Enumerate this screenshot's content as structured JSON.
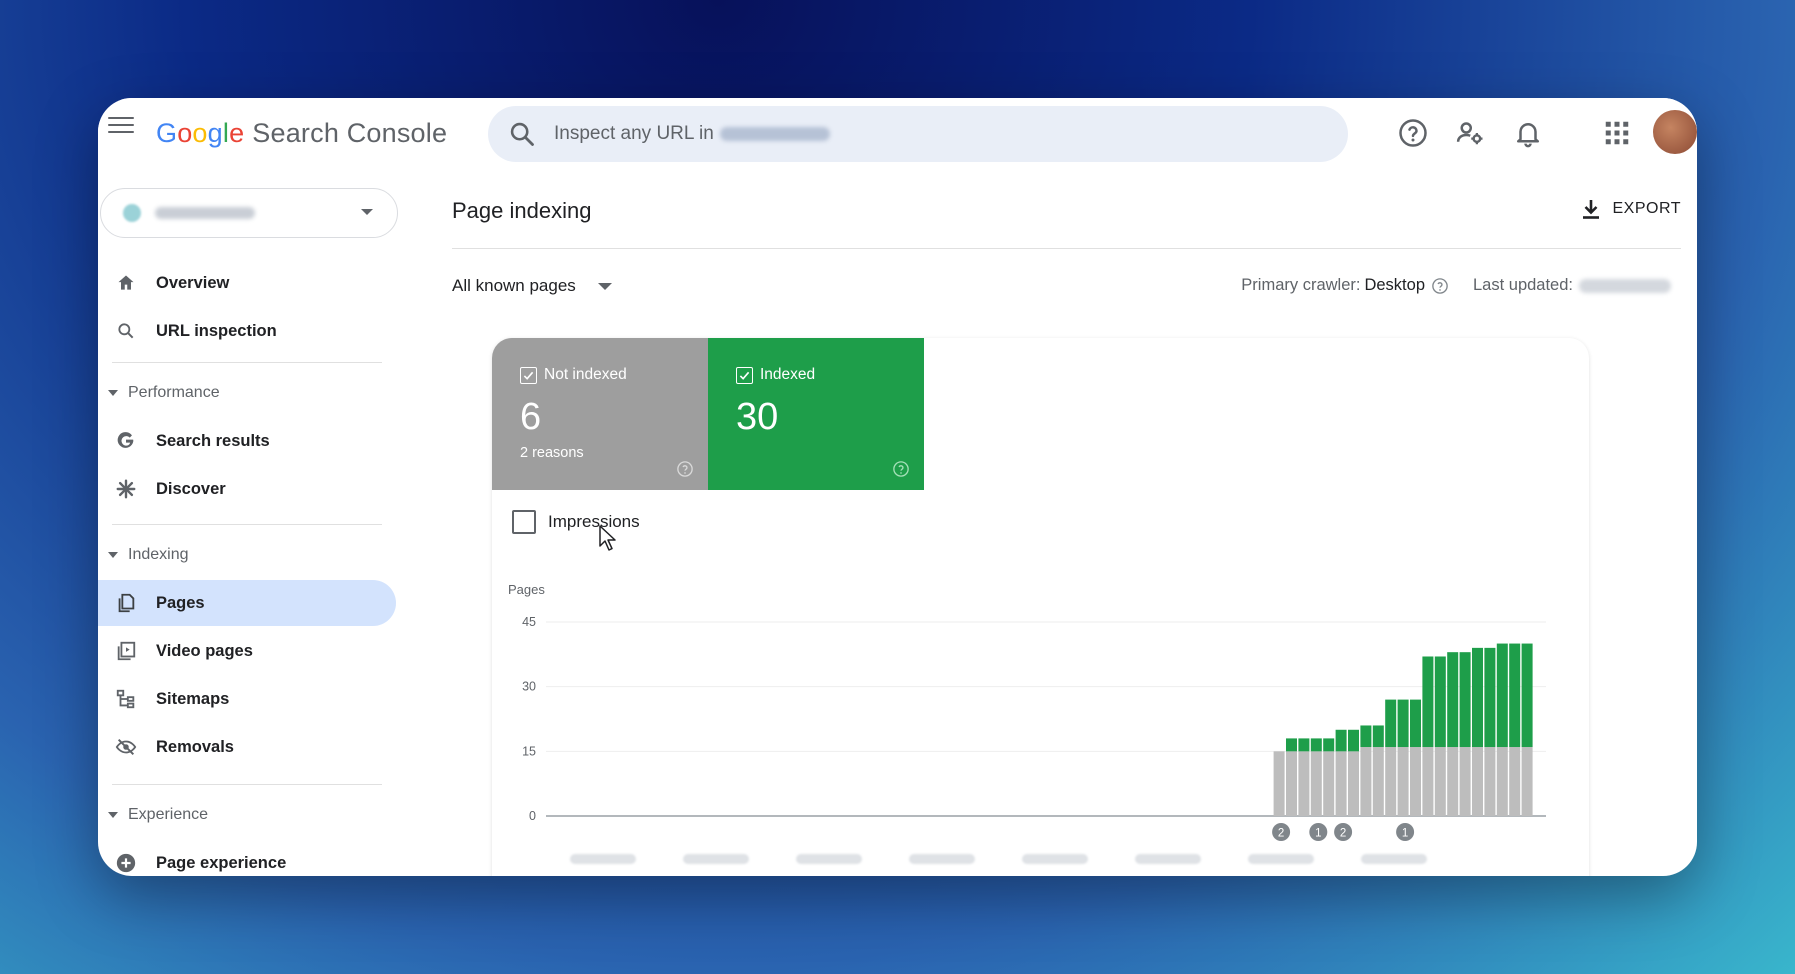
{
  "app": {
    "logo_letters": [
      "G",
      "o",
      "o",
      "g",
      "l",
      "e"
    ],
    "product": "Search Console",
    "search_placeholder": "Inspect any URL in"
  },
  "sidebar": {
    "items": {
      "overview": "Overview",
      "url_inspection": "URL inspection",
      "search_results": "Search results",
      "discover": "Discover",
      "pages": "Pages",
      "video_pages": "Video pages",
      "sitemaps": "Sitemaps",
      "removals": "Removals",
      "page_experience": "Page experience"
    },
    "sections": {
      "performance": "Performance",
      "indexing": "Indexing",
      "experience": "Experience"
    }
  },
  "main": {
    "title": "Page indexing",
    "export_label": "EXPORT",
    "filter_label": "All known pages",
    "crawler_label": "Primary crawler:",
    "crawler_value": "Desktop",
    "last_updated_label": "Last updated:",
    "tiles": {
      "not_indexed": {
        "label": "Not indexed",
        "value": "6",
        "sub": "2 reasons"
      },
      "indexed": {
        "label": "Indexed",
        "value": "30"
      }
    },
    "impressions_label": "Impressions"
  },
  "chart_data": {
    "type": "bar",
    "ylabel": "Pages",
    "yticks": [
      "45",
      "30",
      "15",
      "0"
    ],
    "ylim": [
      0,
      45
    ],
    "stacked": true,
    "colors": {
      "not_indexed": "#bdbdbd",
      "indexed": "#1e9e4a"
    },
    "series": [
      {
        "values": [
          15,
          15,
          15,
          15,
          15,
          15,
          15,
          16,
          16,
          16,
          16,
          16,
          16,
          16,
          16,
          16,
          16,
          16,
          16,
          16,
          16
        ]
      },
      {
        "values": [
          0,
          3,
          3,
          3,
          3,
          5,
          5,
          5,
          5,
          11,
          11,
          11,
          21,
          21,
          22,
          22,
          23,
          23,
          24,
          24,
          24
        ]
      }
    ],
    "annotations": [
      "2",
      "1",
      "2",
      "1"
    ]
  },
  "colors": {
    "accent": "#1a73e8",
    "not_indexed": "#9e9e9e",
    "indexed": "#1e9e4a",
    "active_nav": "#d3e3fd"
  }
}
